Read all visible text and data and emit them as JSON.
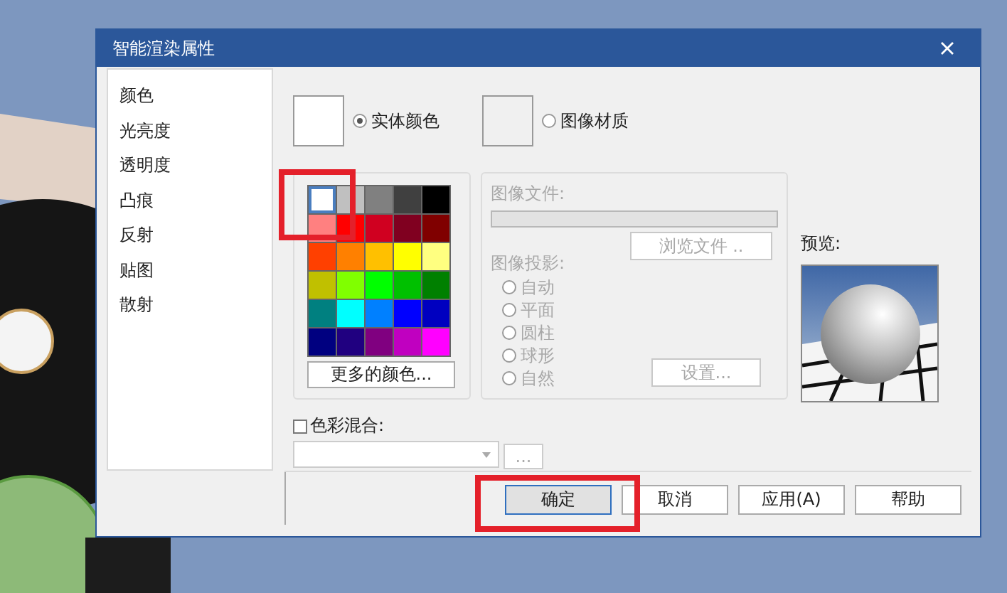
{
  "window": {
    "title": "智能渲染属性"
  },
  "sidebar": {
    "items": [
      {
        "label": "颜色",
        "selected": false
      },
      {
        "label": "光亮度",
        "selected": false
      },
      {
        "label": "透明度",
        "selected": false
      },
      {
        "label": "凸痕",
        "selected": false
      },
      {
        "label": "反射",
        "selected": false
      },
      {
        "label": "贴图",
        "selected": false
      },
      {
        "label": "散射",
        "selected": false
      }
    ]
  },
  "source_options": [
    {
      "label": "实体颜色",
      "selected": true
    },
    {
      "label": "图像材质",
      "selected": false
    }
  ],
  "palette": {
    "swatches": [
      {
        "color": "#ffffff",
        "selected": true
      },
      {
        "color": "#c0c0c0",
        "selected": false
      },
      {
        "color": "#808080",
        "selected": false
      },
      {
        "color": "#404040",
        "selected": false
      },
      {
        "color": "#000000",
        "selected": false
      },
      {
        "color": "#ff8080",
        "selected": false
      },
      {
        "color": "#ff0000",
        "selected": false
      },
      {
        "color": "#d00020",
        "selected": false
      },
      {
        "color": "#800020",
        "selected": false
      },
      {
        "color": "#800000",
        "selected": false
      },
      {
        "color": "#ff4000",
        "selected": false
      },
      {
        "color": "#ff8000",
        "selected": false
      },
      {
        "color": "#ffc000",
        "selected": false
      },
      {
        "color": "#ffff00",
        "selected": false
      },
      {
        "color": "#ffff80",
        "selected": false
      },
      {
        "color": "#c0c000",
        "selected": false
      },
      {
        "color": "#80ff00",
        "selected": false
      },
      {
        "color": "#00ff00",
        "selected": false
      },
      {
        "color": "#00c000",
        "selected": false
      },
      {
        "color": "#008000",
        "selected": false
      },
      {
        "color": "#008080",
        "selected": false
      },
      {
        "color": "#00ffff",
        "selected": false
      },
      {
        "color": "#0080ff",
        "selected": false
      },
      {
        "color": "#0000ff",
        "selected": false
      },
      {
        "color": "#0000c0",
        "selected": false
      },
      {
        "color": "#000080",
        "selected": false
      },
      {
        "color": "#200080",
        "selected": false
      },
      {
        "color": "#800080",
        "selected": false
      },
      {
        "color": "#c000c0",
        "selected": false
      },
      {
        "color": "#ff00ff",
        "selected": false
      }
    ],
    "more_button": "更多的颜色..."
  },
  "image_group": {
    "disabled": true,
    "file_label": "图像文件:",
    "browse_button": "浏览文件 ..",
    "projection_label": "图像投影:",
    "projections": [
      {
        "label": "自动",
        "selected": false
      },
      {
        "label": "平面",
        "selected": false
      },
      {
        "label": "圆柱",
        "selected": false
      },
      {
        "label": "球形",
        "selected": false
      },
      {
        "label": "自然",
        "selected": false
      }
    ],
    "settings_button": "设置..."
  },
  "preview": {
    "label": "预览:"
  },
  "blend": {
    "label": "色彩混合:",
    "checked": false,
    "more_button": "..."
  },
  "buttons": [
    {
      "label": "确定",
      "kind": "default"
    },
    {
      "label": "取消",
      "kind": "normal"
    },
    {
      "label": "应用(A)",
      "kind": "normal"
    },
    {
      "label": "帮助",
      "kind": "normal"
    }
  ]
}
